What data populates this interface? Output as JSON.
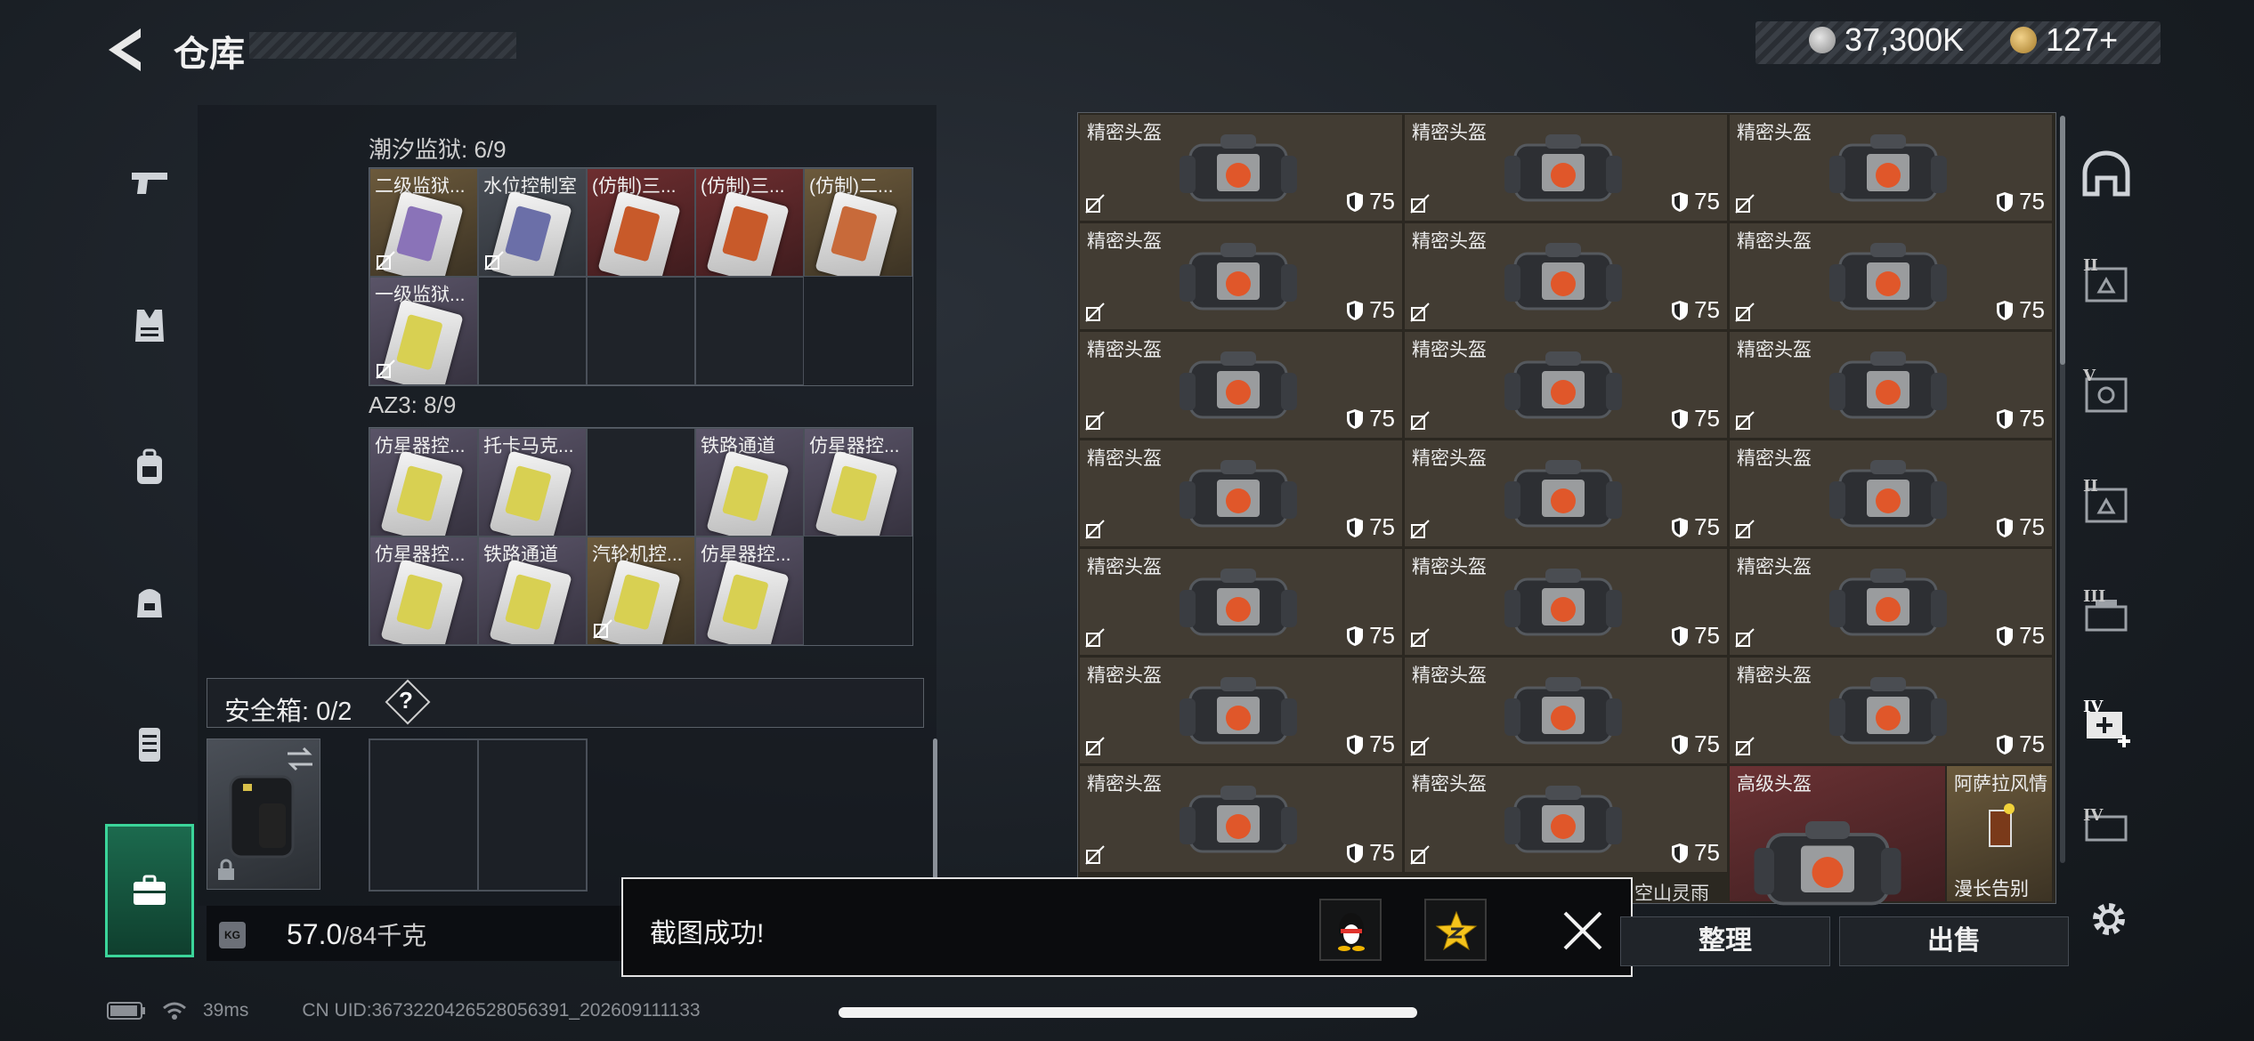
{
  "header": {
    "title": "仓库",
    "silver": "37,300K",
    "gold": "127+"
  },
  "sidebar": {
    "items": [
      "pistol-icon",
      "vest-icon",
      "backpack-icon",
      "pack-icon",
      "armor-icon",
      "case-icon"
    ],
    "active": "case-icon"
  },
  "left_panel": {
    "groups": [
      {
        "title": "潮汐监狱: 6/9",
        "items": [
          {
            "label": "二级监狱...",
            "color": "gold",
            "band": "#8a73b8",
            "nolink": true
          },
          {
            "label": "水位控制室",
            "color": "gray",
            "band": "#6b6fa8",
            "nolink": true
          },
          {
            "label": "(仿制)三...",
            "color": "red",
            "band": "#c85a2a",
            "nolink": false
          },
          {
            "label": "(仿制)三...",
            "color": "red",
            "band": "#c85a2a",
            "nolink": false
          },
          {
            "label": "(仿制)二...",
            "color": "gold",
            "band": "#c86a3a",
            "nolink": false
          },
          {
            "label": "一级监狱...",
            "color": "purple",
            "band": "#d8d052",
            "nolink": true
          }
        ]
      },
      {
        "title": "AZ3: 8/9",
        "items": [
          {
            "label": "仿星器控...",
            "color": "purple",
            "band": "#d8d052",
            "nolink": false
          },
          {
            "label": "托卡马克...",
            "color": "purple",
            "band": "#d8d052",
            "nolink": false
          },
          {
            "label": "",
            "color": "empty",
            "band": "",
            "nolink": false
          },
          {
            "label": "铁路通道",
            "color": "purple",
            "band": "#d8d052",
            "nolink": false
          },
          {
            "label": "仿星器控...",
            "color": "purple",
            "band": "#d8d052",
            "nolink": false
          },
          {
            "label": "仿星器控...",
            "color": "purple",
            "band": "#d8d052",
            "nolink": false
          },
          {
            "label": "铁路通道",
            "color": "purple",
            "band": "#d8d052",
            "nolink": false
          },
          {
            "label": "汽轮机控...",
            "color": "gold",
            "band": "#d8d052",
            "nolink": true
          },
          {
            "label": "仿星器控...",
            "color": "purple",
            "band": "#d8d052",
            "nolink": false
          }
        ]
      }
    ],
    "safe_box": {
      "label": "安全箱: 0/2",
      "help": "?"
    },
    "weight": {
      "current": "57.0",
      "max": "/84千克",
      "icon_text": "KG"
    }
  },
  "stash": {
    "helmet_label": "精密头盔",
    "defense": "75",
    "last_row": {
      "advanced": "高级头盔",
      "drink": "阿萨拉风情",
      "drink_sub": "漫长告别",
      "hidden_label": "空山灵雨"
    }
  },
  "buttons": {
    "tidy": "整理",
    "sell": "出售"
  },
  "toast": {
    "text": "截图成功!"
  },
  "status": {
    "ping": "39ms",
    "uid": "CN UID:3673220426528056391_202609111133"
  }
}
